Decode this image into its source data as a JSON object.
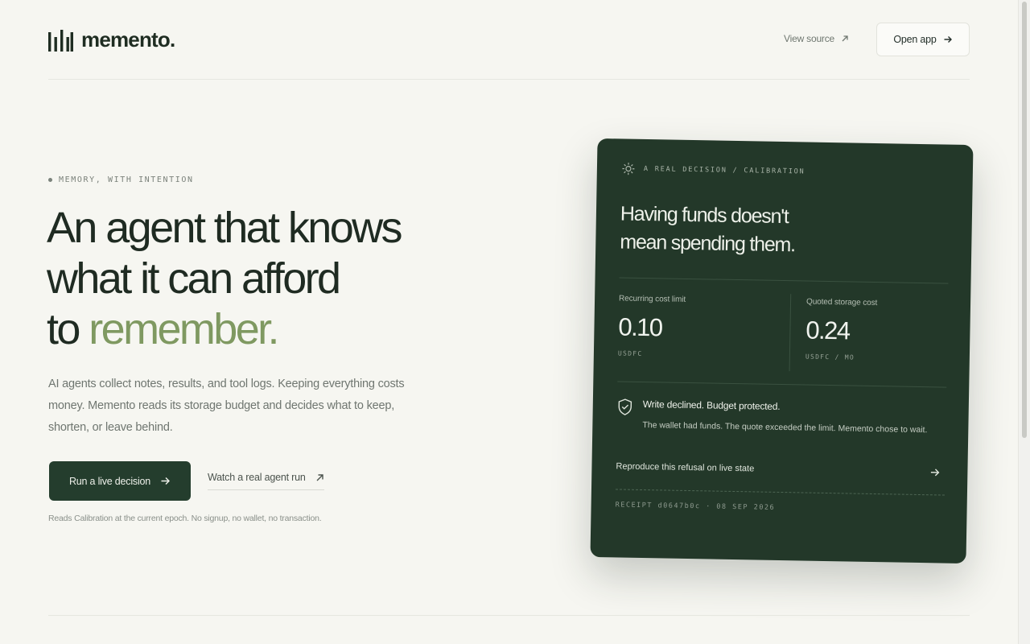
{
  "header": {
    "brand_name": "memento.",
    "view_source_label": "View source",
    "open_app_label": "Open app"
  },
  "hero": {
    "eyebrow": "MEMORY, WITH INTENTION",
    "headline_line1": "An agent that knows",
    "headline_line2": "what it can afford",
    "headline_line3_prefix": "to ",
    "headline_line3_accent": "remember.",
    "lede": "AI agents collect notes, results, and tool logs. Keeping everything costs money. Memento reads its storage budget and decides what to keep, shorten, or leave behind.",
    "primary_button": "Run a live decision",
    "secondary_link": "Watch a real agent run",
    "footnote": "Reads Calibration at the current epoch. No signup, no wallet, no transaction."
  },
  "card": {
    "eyebrow": "A REAL DECISION / CALIBRATION",
    "title_line1": "Having funds doesn't",
    "title_line2": "mean spending them.",
    "stat_left": {
      "label": "Recurring cost limit",
      "value": "0.10",
      "unit": "USDFC"
    },
    "stat_right": {
      "label": "Quoted storage cost",
      "value": "0.24",
      "unit": "USDFC / MO"
    },
    "verdict_title": "Write declined. Budget protected.",
    "verdict_text": "The wallet had funds. The quote exceeded the limit. Memento chose to wait.",
    "reproduce_label": "Reproduce this refusal on live state",
    "receipt": "RECEIPT d0647b0c · 08 SEP 2026"
  },
  "colors": {
    "background": "#f6f6f1",
    "card": "#233829",
    "primary_button": "#243d2d",
    "accent": "#7f9961",
    "text": "#1f2b22"
  },
  "icons": {
    "logo": "bar-chart-logo-icon",
    "view_source": "arrow-up-right-icon",
    "open_app": "arrow-right-icon",
    "card_eyebrow": "gear-icon",
    "verdict": "shield-check-icon",
    "reproduce": "arrow-right-icon"
  }
}
